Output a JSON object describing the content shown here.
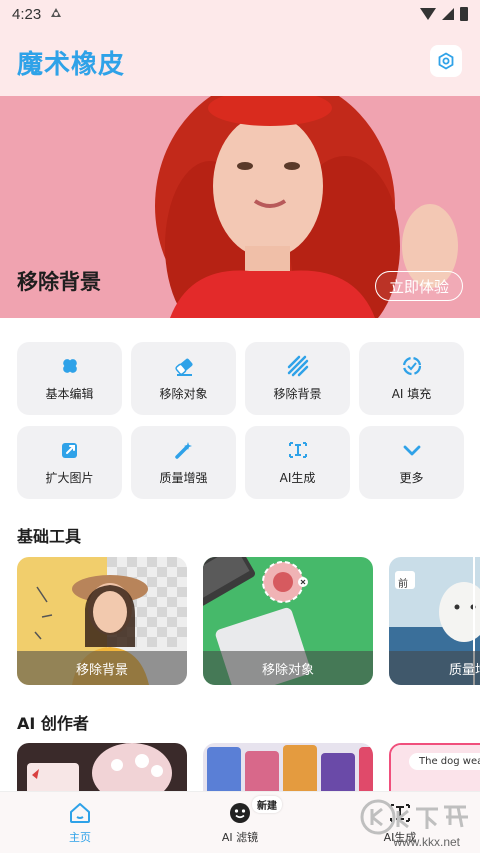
{
  "status_bar": {
    "time": "4:23",
    "app_icon": "app-notification-icon"
  },
  "header": {
    "title": "魔术橡皮",
    "settings_icon": "settings-hexagon-icon"
  },
  "banner": {
    "label": "移除背景",
    "button": "立即体验"
  },
  "features": [
    {
      "label": "基本编辑",
      "icon": "bandage-icon"
    },
    {
      "label": "移除对象",
      "icon": "eraser-icon"
    },
    {
      "label": "移除背景",
      "icon": "stripes-icon"
    },
    {
      "label": "AI 填充",
      "icon": "ai-fill-icon"
    },
    {
      "label": "扩大图片",
      "icon": "expand-icon"
    },
    {
      "label": "质量增强",
      "icon": "magic-wand-icon"
    },
    {
      "label": "AI生成",
      "icon": "text-cursor-icon"
    },
    {
      "label": "更多",
      "icon": "chevron-down-icon"
    }
  ],
  "sections": {
    "basic_tools": "基础工具",
    "ai_creator": "AI 创作者"
  },
  "tool_cards": [
    {
      "label": "移除背景"
    },
    {
      "label": "移除对象"
    },
    {
      "label": "质量增",
      "tag": "前"
    }
  ],
  "creator_cards": [
    {
      "text": ""
    },
    {
      "text": ""
    },
    {
      "text": "The dog wears"
    }
  ],
  "bottom_nav": [
    {
      "label": "主页",
      "icon": "home-icon",
      "active": true
    },
    {
      "label": "AI 滤镜",
      "icon": "face-icon",
      "badge": "新建"
    },
    {
      "label": "AI生成",
      "icon": "text-cursor-icon"
    }
  ],
  "watermark": {
    "text": "www.kkx.net"
  },
  "colors": {
    "accent": "#2fa2e8",
    "header_bg": "#fde9ea",
    "card_bg": "#f1f1f3"
  }
}
